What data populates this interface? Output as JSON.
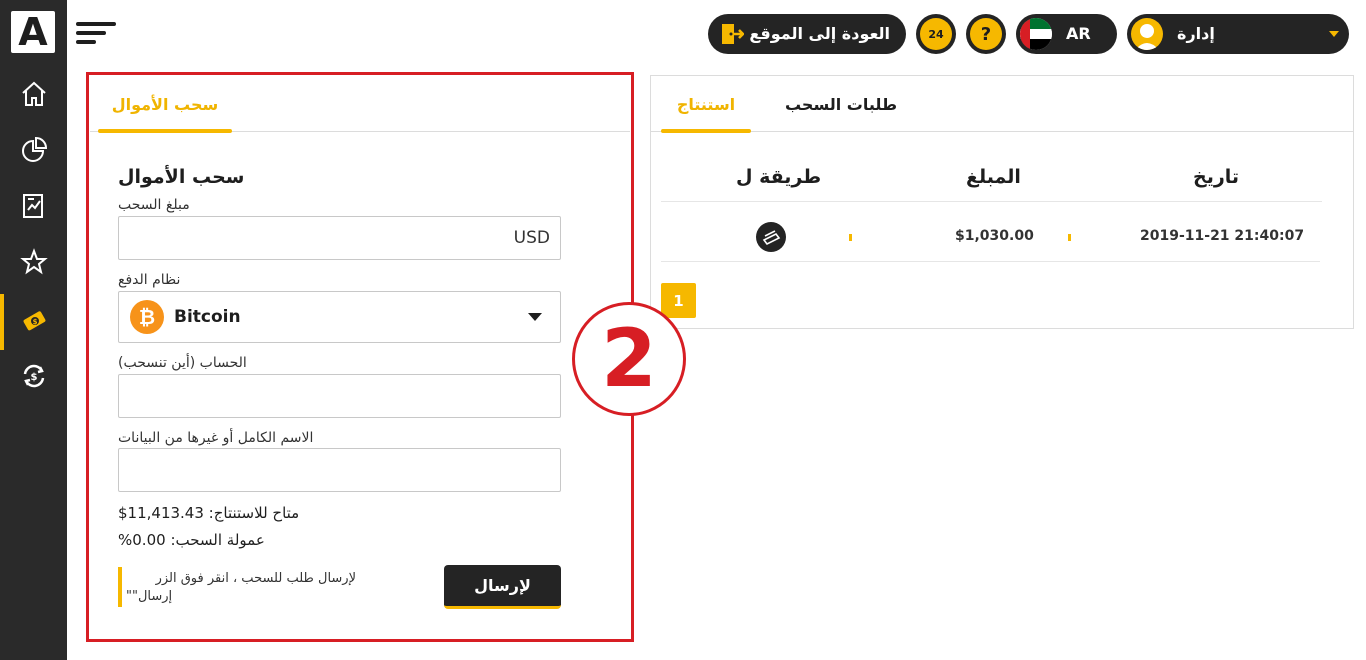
{
  "sidebar": {
    "logo_letter": "A",
    "items": [
      {
        "icon": "home-icon"
      },
      {
        "icon": "pie-chart-icon"
      },
      {
        "icon": "report-icon"
      },
      {
        "icon": "star-icon"
      },
      {
        "icon": "withdraw-icon",
        "active": true
      },
      {
        "icon": "exchange-icon"
      }
    ]
  },
  "header": {
    "back_to_site": "العودة إلى الموقع",
    "support_label": "24",
    "help_label": "?",
    "language": "AR",
    "user_name": "إدارة"
  },
  "withdraw_panel": {
    "tab_label": "سحب الأموال",
    "form_title": "سحب الأموال",
    "amount_label": "مبلغ السحب",
    "amount_value": "USD",
    "payment_system_label": "نظام الدفع",
    "payment_system_value": "Bitcoin",
    "account_label": "الحساب (أين تنسحب)",
    "account_value": "",
    "fullname_label": "الاسم الكامل أو غيرها من البيانات",
    "fullname_value": "",
    "available_text": "$متاح للاستنتاج: 11,413.43",
    "commission_text": "%عمولة السحب: 0.00",
    "hint_line1": "لإرسال طلب للسحب ، انقر فوق الزر",
    "hint_line2": "\"\"إرسال",
    "submit_label": "لإرسال"
  },
  "requests_panel": {
    "tabs": [
      {
        "label": "استنتاج",
        "active": true
      },
      {
        "label": "طلبات السحب",
        "active": false
      }
    ],
    "columns": [
      "تاريخ",
      "المبلغ",
      "طريقة ل"
    ],
    "rows": [
      {
        "date": "2019-11-21 21:40:07",
        "amount": "$1,030.00",
        "method_icon": "wallet-icon"
      }
    ],
    "pagination": [
      "1"
    ]
  },
  "annotation": {
    "number": "2"
  },
  "colors": {
    "accent": "#f6b800",
    "dark": "#242424",
    "annotation_red": "#d71e24"
  }
}
